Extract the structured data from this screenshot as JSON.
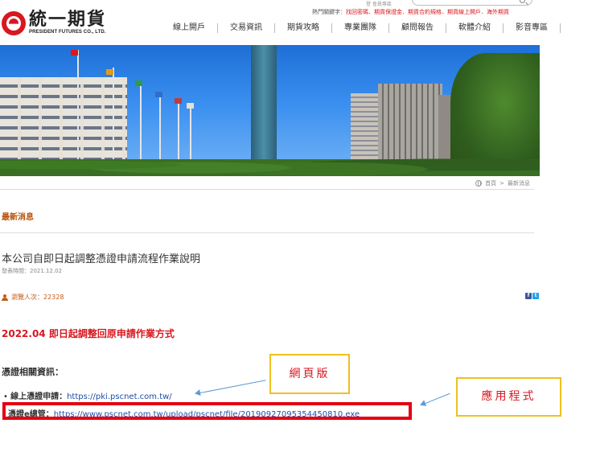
{
  "header": {
    "logo_cn": "統一期貨",
    "logo_en": "PRESIDENT FUTURES CO., LTD.",
    "top_tiny": "登  會員專區",
    "hot_label": "熱門關鍵字：",
    "hot_links": "找回密碼．期貨保證金．期貨合約規格．期貨線上開戶．海外期貨",
    "search_placeholder": "",
    "nav": [
      "線上開戶",
      "交易資訊",
      "期貨攻略",
      "專業團隊",
      "顧問報告",
      "軟體介紹",
      "影音專區"
    ]
  },
  "breadcrumb": {
    "home": "首頁",
    "separator": ">",
    "current": "最新消息"
  },
  "section_title": "最新消息",
  "article": {
    "title": "本公司自即日起調整憑證申請流程作業說明",
    "date_label": "發表時間：",
    "date": "2021.12.02",
    "views_label": "瀏覽人次：",
    "views": "22328",
    "share_fb": "f",
    "share_tw": "t",
    "announcement": "2022.04 即日起調整回原申請作業方式",
    "cert_heading": "憑證相關資訊：",
    "links": [
      {
        "label": "線上憑證申請：",
        "url": "https://pki.pscnet.com.tw/"
      },
      {
        "label": "憑證e總管：",
        "url": "https://www.pscnet.com.tw/upload/pscnet/file/20190927095354450810.exe"
      }
    ]
  },
  "callouts": {
    "web": "網頁版",
    "app": "應用程式"
  },
  "colors": {
    "brand_red": "#d7181f",
    "section_orange": "#b5530c",
    "link_blue": "#1f4ea3",
    "frame_red": "#e60012",
    "callout_border": "#f0c020"
  }
}
